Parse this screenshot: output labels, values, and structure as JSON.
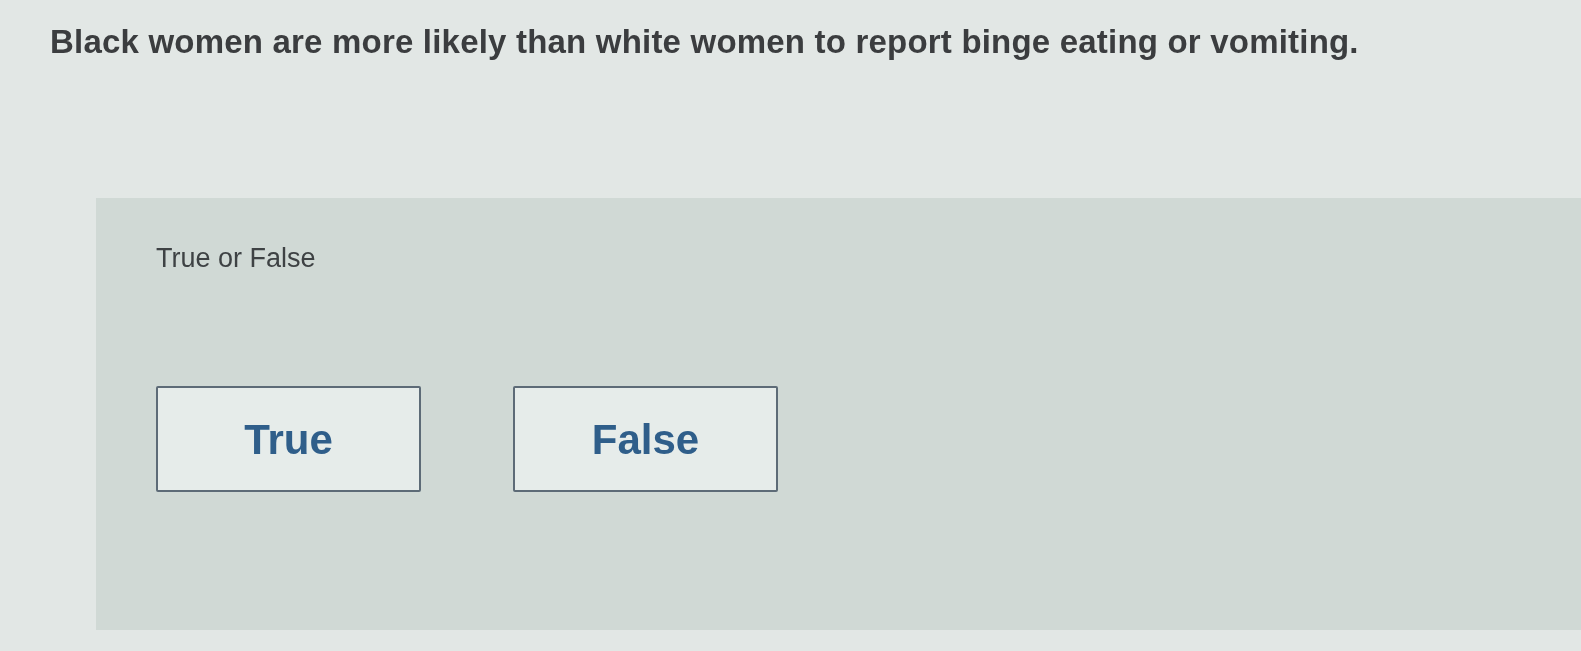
{
  "question": "Black women are more likely than white women to report binge eating or vomiting.",
  "answer_panel": {
    "prompt": "True or False",
    "options": [
      {
        "label": "True",
        "selected": false
      },
      {
        "label": "False",
        "selected": false
      }
    ]
  }
}
